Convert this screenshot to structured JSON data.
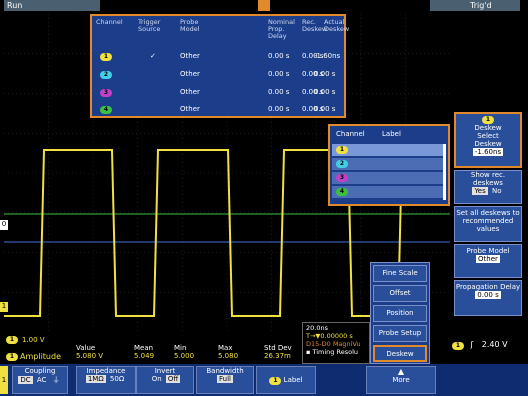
{
  "status": {
    "run": "Run",
    "triggered": "Trig'd"
  },
  "channel_colors": {
    "ch1": "#f0e040",
    "ch2": "#3fd0e8",
    "ch3": "#c040c8",
    "ch4": "#3cc040"
  },
  "deskew_table": {
    "headers": [
      "Channel",
      "Trigger Source",
      "Probe Model",
      "Nominal Prop. Delay",
      "Rec. Deskew",
      "Actual Deskew"
    ],
    "rows": [
      {
        "ch": "1",
        "trigger": "✓",
        "probe": "Other",
        "nominal": "0.00 s",
        "rec": "0.00 s",
        "actual": "-1.60ns"
      },
      {
        "ch": "2",
        "trigger": "",
        "probe": "Other",
        "nominal": "0.00 s",
        "rec": "0.00 s",
        "actual": "0.00 s"
      },
      {
        "ch": "3",
        "trigger": "",
        "probe": "Other",
        "nominal": "0.00 s",
        "rec": "0.00 s",
        "actual": "0.00 s"
      },
      {
        "ch": "4",
        "trigger": "",
        "probe": "Other",
        "nominal": "0.00 s",
        "rec": "0.00 s",
        "actual": "0.00 s"
      }
    ]
  },
  "label_panel": {
    "headers": [
      "Channel",
      "Label"
    ],
    "rows": [
      "1",
      "2",
      "3",
      "4"
    ]
  },
  "side_menu": {
    "deskew_title": "Deskew",
    "select_label": "Select",
    "deskew_label": "Deskew",
    "deskew_value": "-1.60ns",
    "show_rec_label": "Show rec. deskews",
    "yes_label": "Yes",
    "no_label": "No",
    "set_all_label": "Set all deskews to recommended values",
    "probe_model_label": "Probe Model",
    "probe_model_value": "Other",
    "prop_delay_label": "Propagation Delay",
    "prop_delay_value": "0.00 s"
  },
  "popup_menu": [
    "Fine Scale",
    "Offset",
    "Position",
    "Probe Setup",
    "Deskew"
  ],
  "measurement": {
    "scale": "1.00 V",
    "headers": [
      "Value",
      "Mean",
      "Min",
      "Max",
      "Std Dev"
    ],
    "name": "Amplitude",
    "values": [
      "5.080 V",
      "5.049",
      "5.000",
      "5.080",
      "26.37m"
    ]
  },
  "timebase": {
    "scale": "20.0ns",
    "position": "T→▼0.00000 s",
    "magnivu": "D15-D0 MagniVu",
    "timing": "▪ Timing Resolu"
  },
  "trigger_info": {
    "level": "2.40 V",
    "slope": "ʃ"
  },
  "bottom_menu": {
    "coupling": {
      "label": "Coupling",
      "options": [
        "DC",
        "AC",
        "⏚"
      ]
    },
    "impedance": {
      "label": "Impedance",
      "options": [
        "1MΩ",
        "50Ω"
      ]
    },
    "invert": {
      "label": "Invert",
      "options": [
        "On",
        "Off"
      ]
    },
    "bandwidth": {
      "label": "Bandwidth",
      "value": "Full"
    },
    "label_btn": "Label",
    "more": "More"
  },
  "markers": {
    "ground": "1",
    "ref": "0"
  }
}
